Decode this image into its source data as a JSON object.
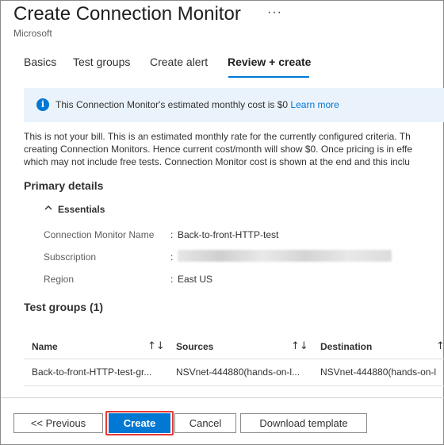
{
  "header": {
    "title": "Create Connection Monitor",
    "more_label": "···",
    "subtitle": "Microsoft"
  },
  "tabs": [
    {
      "label": "Basics",
      "active": false
    },
    {
      "label": "Test groups",
      "active": false
    },
    {
      "label": "Create alert",
      "active": false
    },
    {
      "label": "Review + create",
      "active": true
    }
  ],
  "info_bar": {
    "icon": "info-icon",
    "text": "This Connection Monitor's estimated monthly cost is $0 ",
    "link": "Learn more"
  },
  "paragraph": [
    "This is not your bill. This is an estimated monthly rate for the currently configured criteria. Th",
    "creating Connection Monitors. Hence current cost/month will show $0. Once pricing is in effe",
    "which may not include free tests. Connection Monitor cost is shown at the end and this inclu"
  ],
  "primary_details": {
    "heading": "Primary details",
    "essentials_label": "Essentials",
    "fields": [
      {
        "label": "Connection Monitor Name",
        "value": "Back-to-front-HTTP-test"
      },
      {
        "label": "Subscription",
        "value": ""
      },
      {
        "label": "Region",
        "value": "East US"
      }
    ]
  },
  "test_groups": {
    "heading": "Test groups (1)",
    "columns": [
      "Name",
      "Sources",
      "Destination"
    ],
    "rows": [
      [
        "Back-to-front-HTTP-test-gr...",
        "NSVnet-444880(hands-on-l...",
        "NSVnet-444880(hands-on-l"
      ]
    ]
  },
  "footer": {
    "previous_label": "<< Previous",
    "create_label": "Create",
    "cancel_label": "Cancel",
    "download_label": "Download template"
  },
  "colors": {
    "accent": "#0078d4",
    "info_bg": "#eaf3fc",
    "highlight": "#e53935"
  }
}
